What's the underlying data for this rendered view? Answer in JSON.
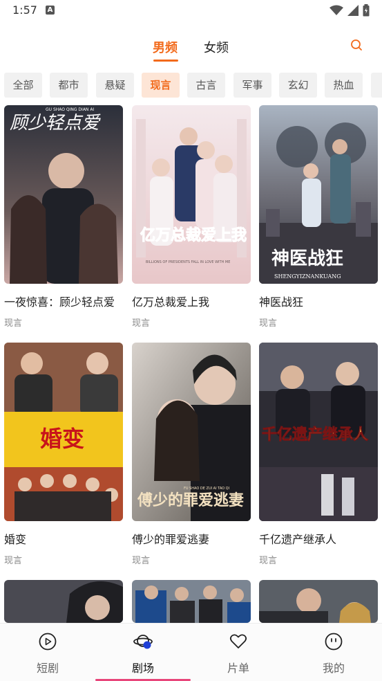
{
  "status_bar": {
    "time": "1:57",
    "notif_icon": "a-icon"
  },
  "header": {
    "tabs": [
      {
        "label": "男频",
        "active": true
      },
      {
        "label": "女频",
        "active": false
      }
    ],
    "search_icon": "search-icon",
    "accent_color": "#f26a1b"
  },
  "genres": [
    {
      "label": "全部",
      "active": false
    },
    {
      "label": "都市",
      "active": false
    },
    {
      "label": "悬疑",
      "active": false
    },
    {
      "label": "现言",
      "active": true
    },
    {
      "label": "古言",
      "active": false
    },
    {
      "label": "军事",
      "active": false
    },
    {
      "label": "玄幻",
      "active": false
    },
    {
      "label": "热血",
      "active": false
    },
    {
      "label": "历",
      "active": false
    }
  ],
  "dramas": [
    {
      "title": "一夜惊喜：顾少轻点爱",
      "tag": "现言",
      "poster_text": "顾少轻点爱",
      "poster_sub": "GU SHAO QING DIAN AI"
    },
    {
      "title": "亿万总裁爱上我",
      "tag": "现言",
      "poster_text": "亿万总裁爱上我",
      "poster_sub": "BILLIONS OF PRESIDENTS FALL IN LOVE WITH ME"
    },
    {
      "title": "神医战狂",
      "tag": "现言",
      "poster_text": "神医战狂",
      "poster_sub": "SHENGYIZNANKUANG"
    },
    {
      "title": "婚变",
      "tag": "现言",
      "poster_text": "婚变",
      "poster_sub": ""
    },
    {
      "title": "傅少的罪爱逃妻",
      "tag": "现言",
      "poster_text": "傅少的罪爱逃妻",
      "poster_sub": "FU SHAO DE ZUI AI TAO QI"
    },
    {
      "title": "千亿遗产继承人",
      "tag": "现言",
      "poster_text": "千亿遗产继承人",
      "poster_sub": ""
    },
    {
      "title": "",
      "tag": "",
      "poster_text": "",
      "poster_sub": ""
    },
    {
      "title": "",
      "tag": "",
      "poster_text": "",
      "poster_sub": ""
    },
    {
      "title": "",
      "tag": "",
      "poster_text": "",
      "poster_sub": ""
    }
  ],
  "bottom_nav": [
    {
      "label": "短剧",
      "icon": "play-circle-icon",
      "active": false
    },
    {
      "label": "剧场",
      "icon": "planet-icon",
      "active": true
    },
    {
      "label": "片单",
      "icon": "heart-icon",
      "active": false
    },
    {
      "label": "我的",
      "icon": "face-icon",
      "active": false
    }
  ]
}
